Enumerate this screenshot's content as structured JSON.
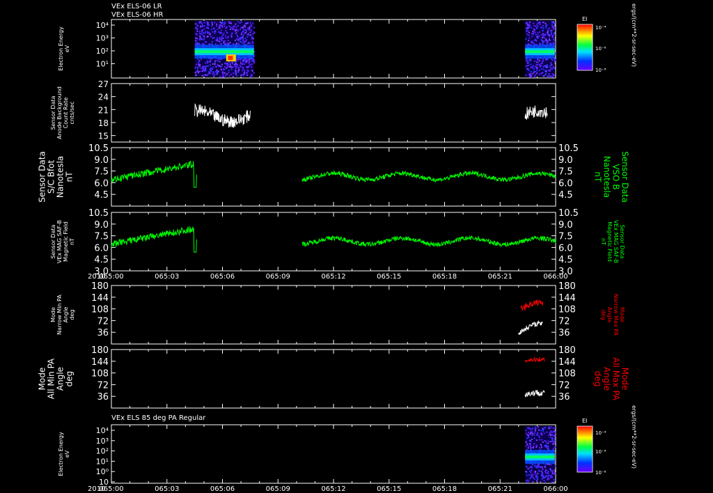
{
  "header": {
    "line1": "VEx ELS-06 LR",
    "line2": "VEx ELS-06 HR",
    "panel7_title": "VEx ELS 85 deg PA Regular"
  },
  "colorbar": {
    "title": "EI",
    "units": "ergs/(cm**2-sr-sec-eV)",
    "ticks": [
      "10⁻⁴",
      "10⁻⁶",
      "10⁻⁸"
    ]
  },
  "colors": {
    "background": "#000000",
    "axis": "#ffffff",
    "green": "#00ff00",
    "red": "#ff0000",
    "white": "#ffffff"
  },
  "chart_data": [
    {
      "type": "heatmap",
      "id": "p1",
      "ylabel": [
        "Electron Energy",
        "eV"
      ],
      "yticks": [
        "10⁴",
        "10³",
        "10²",
        "10¹"
      ],
      "bands": [
        [
          1,
          0.03,
          0.22
        ],
        [
          2,
          0.75,
          0.83
        ]
      ],
      "note": "spectrogram data present roughly 065:04:30–065:07:40 and 065:22:20–065:23:55"
    },
    {
      "type": "line",
      "id": "p2",
      "ylabel": [
        "Sensor Data",
        "Anode Background",
        "Count Rate",
        "cnts/sec"
      ],
      "ylim": [
        13.5,
        27
      ],
      "yticks": [
        27,
        24,
        21,
        18,
        15
      ],
      "series": [
        {
          "color": "white",
          "segments": [
            [
              4.5,
              7.5
            ],
            [
              22.35,
              23.55
            ]
          ],
          "base": 19.5,
          "amp": 2.5,
          "noise": 3
        }
      ]
    },
    {
      "type": "line",
      "id": "p3",
      "ylabel": [
        "Sensor Data",
        "S/C Bfot",
        "Nanotesla",
        "nT"
      ],
      "ylabel_right": [
        "Sensor Data",
        "VSO B",
        "Nanotesla",
        "nT"
      ],
      "ylim": [
        3.0,
        10.5
      ],
      "yticks": [
        "10.5",
        "9.0",
        "7.5",
        "6.0",
        "4.5"
      ],
      "series": [
        {
          "color": "green",
          "segments": [
            [
              0,
              4.6
            ],
            [
              10.3,
              24
            ]
          ],
          "base": 6.8,
          "amp": 0.8,
          "noise": 0.6
        }
      ]
    },
    {
      "type": "line",
      "id": "p4",
      "ylabel": [
        "Sensor Data",
        "VEx MAG SAF-B",
        "Magnetic Field",
        "nT"
      ],
      "ylabel_right": [
        "Sensor Data",
        "VEx MAG SAF-B",
        "Magnetic Field",
        "nT"
      ],
      "ylim": [
        3.0,
        10.5
      ],
      "yticks": [
        "10.5",
        "9.0",
        "7.5",
        "6.0",
        "4.5",
        "3.0"
      ],
      "series": [
        {
          "color": "green",
          "segments": [
            [
              0,
              4.6
            ],
            [
              10.3,
              24
            ]
          ],
          "base": 6.8,
          "amp": 0.8,
          "noise": 0.6
        }
      ]
    },
    {
      "type": "line",
      "id": "p5",
      "ylabel": [
        "Mode",
        "Narrow Min PA",
        "Angle",
        "deg"
      ],
      "ylabel_right": [
        "Mode",
        "Narrow Max PA",
        "Angle",
        "deg"
      ],
      "ylim": [
        0,
        180
      ],
      "yticks": [
        180,
        144,
        108,
        72,
        36
      ],
      "series": [
        {
          "color": "red",
          "segments": [
            [
              22.1,
              23.3
            ]
          ],
          "base": 110,
          "amp": 35,
          "noise": 20
        },
        {
          "color": "white",
          "segments": [
            [
              22.0,
              23.3
            ]
          ],
          "base": 40,
          "amp": 45,
          "noise": 15
        }
      ]
    },
    {
      "type": "line",
      "id": "p6",
      "ylabel": [
        "Mode",
        "All Min PA",
        "Angle",
        "deg"
      ],
      "ylabel_right": [
        "Mode",
        "All Max PA",
        "Angle",
        "deg"
      ],
      "ylim": [
        0,
        180
      ],
      "yticks": [
        180,
        144,
        108,
        72,
        36
      ],
      "series": [
        {
          "color": "red",
          "segments": [
            [
              22.35,
              23.4
            ]
          ],
          "base": 145,
          "amp": 10,
          "noise": 15
        },
        {
          "color": "white",
          "segments": [
            [
              22.35,
              23.4
            ]
          ],
          "base": 40,
          "amp": 15,
          "noise": 20
        }
      ]
    },
    {
      "type": "heatmap",
      "id": "p7",
      "ylabel": [
        "Electron Energy",
        "eV"
      ],
      "yticks": [
        "10⁴",
        "10³",
        "10²",
        "10¹",
        "10⁰",
        "10"
      ],
      "bands": [
        [
          2,
          0.75,
          0.83
        ]
      ],
      "note": "spectrogram data present roughly 065:22:20–065:23:55"
    }
  ],
  "xaxis": {
    "year": "2010",
    "ticks": [
      "065:00",
      "065:03",
      "065:06",
      "065:09",
      "065:12",
      "065:15",
      "065:18",
      "065:21",
      "066:00"
    ],
    "range_min": [
      0,
      24
    ]
  }
}
